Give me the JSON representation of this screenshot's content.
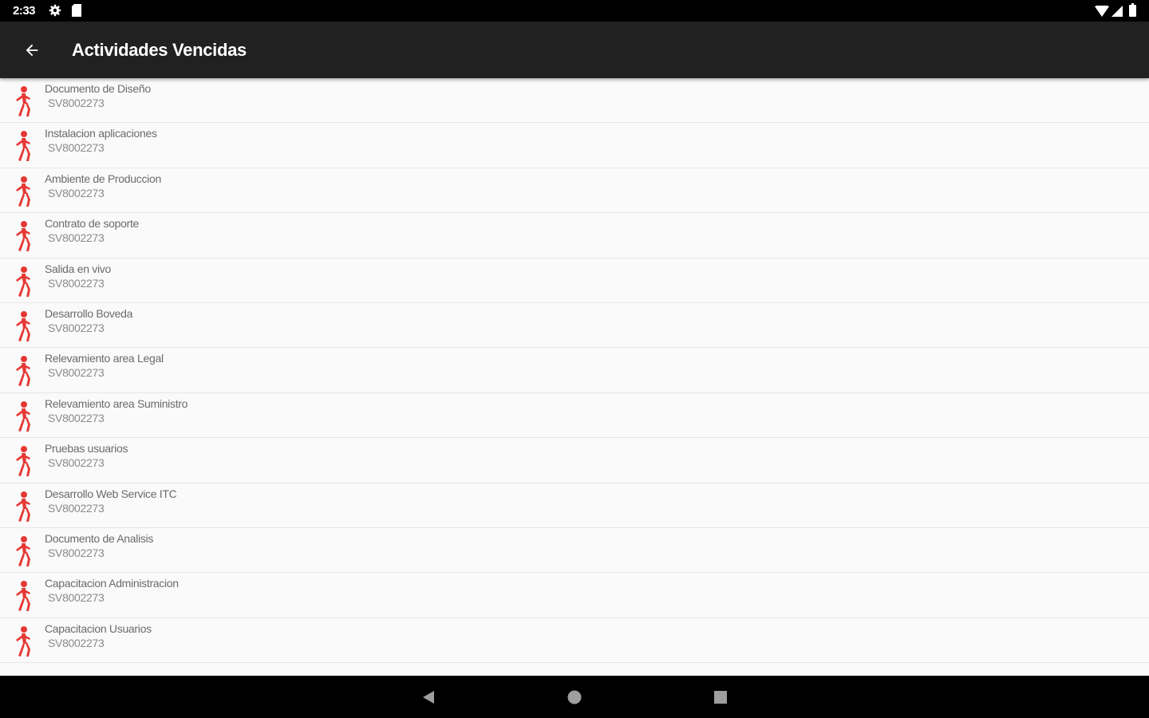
{
  "status_bar": {
    "time": "2:33",
    "icons": [
      "gear-icon",
      "sd-card-icon",
      "wifi-icon",
      "signal-icon",
      "battery-icon"
    ]
  },
  "app_bar": {
    "title": "Actividades Vencidas",
    "back_icon": "arrow-back-icon",
    "background": "#212121"
  },
  "list": {
    "icon": "person-walking-icon",
    "icon_color": "#e53935",
    "items": [
      {
        "title": "Documento de Diseño",
        "code": "SV8002273"
      },
      {
        "title": "Instalacion aplicaciones",
        "code": "SV8002273"
      },
      {
        "title": "Ambiente de Produccion",
        "code": "SV8002273"
      },
      {
        "title": "Contrato de soporte",
        "code": "SV8002273"
      },
      {
        "title": "Salida en vivo",
        "code": "SV8002273"
      },
      {
        "title": "Desarrollo Boveda",
        "code": "SV8002273"
      },
      {
        "title": "Relevamiento area Legal",
        "code": "SV8002273"
      },
      {
        "title": "Relevamiento area Suministro",
        "code": "SV8002273"
      },
      {
        "title": "Pruebas usuarios",
        "code": "SV8002273"
      },
      {
        "title": "Desarrollo Web Service ITC",
        "code": "SV8002273"
      },
      {
        "title": "Documento de Analisis",
        "code": "SV8002273"
      },
      {
        "title": "Capacitacion Administracion",
        "code": "SV8002273"
      },
      {
        "title": "Capacitacion Usuarios",
        "code": "SV8002273"
      }
    ]
  },
  "nav_bar": {
    "icons": [
      "nav-back-icon",
      "nav-home-icon",
      "nav-recents-icon"
    ]
  }
}
